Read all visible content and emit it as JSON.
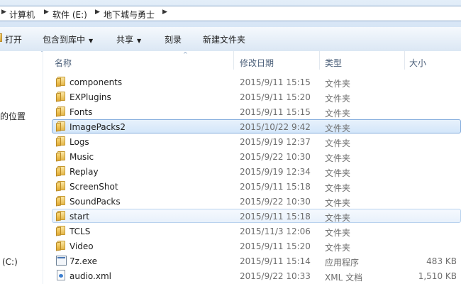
{
  "breadcrumb": {
    "items": [
      {
        "label": "计算机"
      },
      {
        "label": "软件 (E:)"
      },
      {
        "label": "地下城与勇士"
      }
    ]
  },
  "toolbar": {
    "open": "打开",
    "include_library": "包含到库中",
    "share": "共享",
    "burn": "刻录",
    "new_folder": "新建文件夹",
    "dropdown_glyph": "▼"
  },
  "nav": {
    "recent_places_fragment": "的位置",
    "drive_fragment": "(C:)"
  },
  "columns": {
    "name": "名称",
    "date": "修改日期",
    "type": "类型",
    "size": "大小"
  },
  "sort_glyph": "^",
  "files": [
    {
      "name": "components",
      "date": "2015/9/11 15:15",
      "type": "文件夹",
      "size": "",
      "icon": "folder-icon",
      "state": "normal"
    },
    {
      "name": "EXPlugins",
      "date": "2015/9/11 15:20",
      "type": "文件夹",
      "size": "",
      "icon": "folder-icon",
      "state": "normal"
    },
    {
      "name": "Fonts",
      "date": "2015/9/11 15:15",
      "type": "文件夹",
      "size": "",
      "icon": "folder-icon",
      "state": "normal"
    },
    {
      "name": "ImagePacks2",
      "date": "2015/10/22 9:42",
      "type": "文件夹",
      "size": "",
      "icon": "folder-icon",
      "state": "selected"
    },
    {
      "name": "Logs",
      "date": "2015/9/19 12:37",
      "type": "文件夹",
      "size": "",
      "icon": "folder-icon",
      "state": "normal"
    },
    {
      "name": "Music",
      "date": "2015/9/22 10:30",
      "type": "文件夹",
      "size": "",
      "icon": "folder-icon",
      "state": "normal"
    },
    {
      "name": "Replay",
      "date": "2015/9/19 12:34",
      "type": "文件夹",
      "size": "",
      "icon": "folder-icon",
      "state": "normal"
    },
    {
      "name": "ScreenShot",
      "date": "2015/9/11 15:18",
      "type": "文件夹",
      "size": "",
      "icon": "folder-icon",
      "state": "normal"
    },
    {
      "name": "SoundPacks",
      "date": "2015/9/22 10:30",
      "type": "文件夹",
      "size": "",
      "icon": "folder-icon",
      "state": "normal"
    },
    {
      "name": "start",
      "date": "2015/9/11 15:18",
      "type": "文件夹",
      "size": "",
      "icon": "folder-icon",
      "state": "hover"
    },
    {
      "name": "TCLS",
      "date": "2015/11/3 12:06",
      "type": "文件夹",
      "size": "",
      "icon": "folder-icon",
      "state": "normal"
    },
    {
      "name": "Video",
      "date": "2015/9/11 15:20",
      "type": "文件夹",
      "size": "",
      "icon": "folder-icon",
      "state": "normal"
    },
    {
      "name": "7z.exe",
      "date": "2015/9/11 15:14",
      "type": "应用程序",
      "size": "483 KB",
      "icon": "exe-icon",
      "state": "normal"
    },
    {
      "name": "audio.xml",
      "date": "2015/9/22 10:33",
      "type": "XML 文档",
      "size": "1,510 KB",
      "icon": "xml-file-icon",
      "state": "normal"
    }
  ],
  "colors": {
    "selection_border": "#84acdd",
    "selection_fill": "#d3e6fa",
    "header_text": "#4c607a"
  }
}
